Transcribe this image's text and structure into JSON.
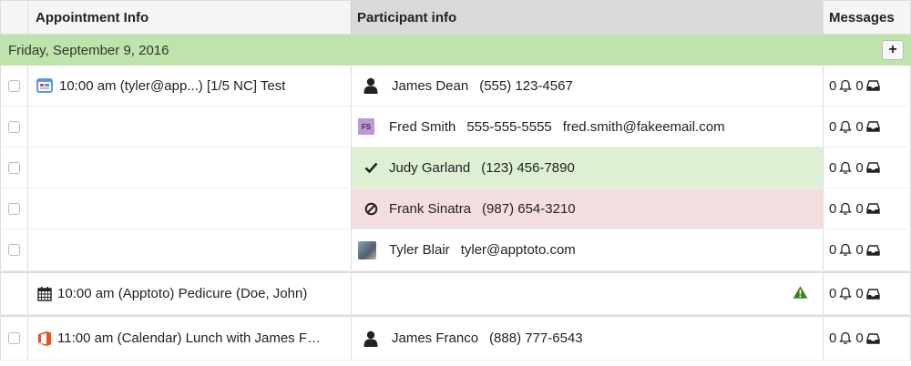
{
  "header": {
    "appointment_info": "Appointment Info",
    "participant_info": "Participant info",
    "messages": "Messages"
  },
  "date_group": {
    "label": "Friday, September 9, 2016",
    "add_label": "+"
  },
  "appointments": [
    {
      "icon": "calendar-app-icon",
      "text": "10:00 am  (tyler@app...) [1/5 NC] Test",
      "participants": [
        {
          "icon": "person-icon",
          "name": "James Dean",
          "phone": "(555) 123-4567",
          "email": "",
          "status": "none",
          "sms_count": "0",
          "email_count": "0"
        },
        {
          "icon": "initials-badge",
          "initials": "FS",
          "name": "Fred Smith",
          "phone": "555-555-5555",
          "email": "fred.smith@fakeemail.com",
          "status": "none",
          "sms_count": "0",
          "email_count": "0"
        },
        {
          "icon": "check-icon",
          "name": "Judy Garland",
          "phone": "(123) 456-7890",
          "email": "",
          "status": "confirmed",
          "sms_count": "0",
          "email_count": "0"
        },
        {
          "icon": "ban-icon",
          "name": "Frank Sinatra",
          "phone": "(987) 654-3210",
          "email": "",
          "status": "cancelled",
          "sms_count": "0",
          "email_count": "0"
        },
        {
          "icon": "avatar-photo",
          "name": "Tyler Blair",
          "phone": "",
          "email": "tyler@apptoto.com",
          "status": "none",
          "sms_count": "0",
          "email_count": "0"
        }
      ]
    },
    {
      "icon": "calendar-grid-icon",
      "text": "10:00 am  (Apptoto) Pedicure (Doe, John)",
      "participants": [
        {
          "icon": "warning-icon",
          "name": "",
          "phone": "",
          "email": "",
          "status": "warning",
          "sms_count": "0",
          "email_count": "0"
        }
      ]
    },
    {
      "icon": "office-icon",
      "text": "11:00 am  (Calendar) Lunch with James F…",
      "participants": [
        {
          "icon": "person-icon",
          "name": "James Franco",
          "phone": "(888) 777-6543",
          "email": "",
          "status": "none",
          "sms_count": "0",
          "email_count": "0"
        }
      ]
    }
  ],
  "colors": {
    "date_row_bg": "#bfe4ab",
    "confirmed_bg": "#ddf0d4",
    "cancelled_bg": "#f2dede",
    "warning": "#3f7f1f",
    "office_orange": "#e8521f"
  }
}
